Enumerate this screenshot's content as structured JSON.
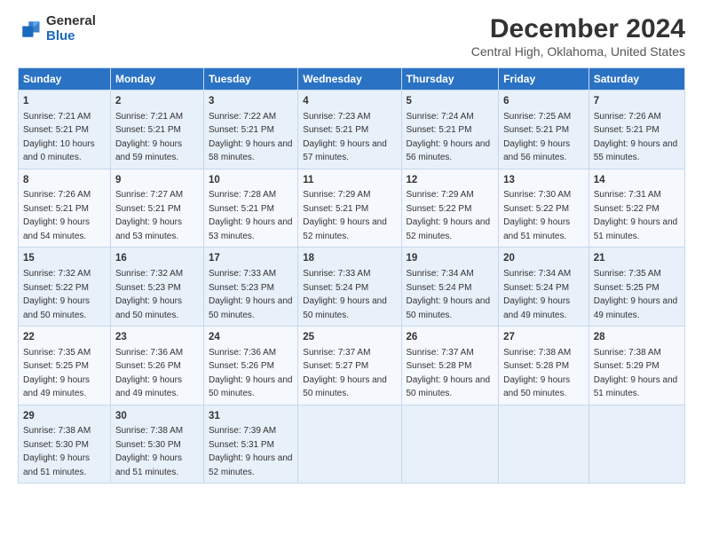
{
  "logo": {
    "general": "General",
    "blue": "Blue"
  },
  "title": "December 2024",
  "subtitle": "Central High, Oklahoma, United States",
  "days_header": [
    "Sunday",
    "Monday",
    "Tuesday",
    "Wednesday",
    "Thursday",
    "Friday",
    "Saturday"
  ],
  "weeks": [
    [
      {
        "num": "1",
        "sunrise": "7:21 AM",
        "sunset": "5:21 PM",
        "daylight": "10 hours and 0 minutes."
      },
      {
        "num": "2",
        "sunrise": "7:21 AM",
        "sunset": "5:21 PM",
        "daylight": "9 hours and 59 minutes."
      },
      {
        "num": "3",
        "sunrise": "7:22 AM",
        "sunset": "5:21 PM",
        "daylight": "9 hours and 58 minutes."
      },
      {
        "num": "4",
        "sunrise": "7:23 AM",
        "sunset": "5:21 PM",
        "daylight": "9 hours and 57 minutes."
      },
      {
        "num": "5",
        "sunrise": "7:24 AM",
        "sunset": "5:21 PM",
        "daylight": "9 hours and 56 minutes."
      },
      {
        "num": "6",
        "sunrise": "7:25 AM",
        "sunset": "5:21 PM",
        "daylight": "9 hours and 56 minutes."
      },
      {
        "num": "7",
        "sunrise": "7:26 AM",
        "sunset": "5:21 PM",
        "daylight": "9 hours and 55 minutes."
      }
    ],
    [
      {
        "num": "8",
        "sunrise": "7:26 AM",
        "sunset": "5:21 PM",
        "daylight": "9 hours and 54 minutes."
      },
      {
        "num": "9",
        "sunrise": "7:27 AM",
        "sunset": "5:21 PM",
        "daylight": "9 hours and 53 minutes."
      },
      {
        "num": "10",
        "sunrise": "7:28 AM",
        "sunset": "5:21 PM",
        "daylight": "9 hours and 53 minutes."
      },
      {
        "num": "11",
        "sunrise": "7:29 AM",
        "sunset": "5:21 PM",
        "daylight": "9 hours and 52 minutes."
      },
      {
        "num": "12",
        "sunrise": "7:29 AM",
        "sunset": "5:22 PM",
        "daylight": "9 hours and 52 minutes."
      },
      {
        "num": "13",
        "sunrise": "7:30 AM",
        "sunset": "5:22 PM",
        "daylight": "9 hours and 51 minutes."
      },
      {
        "num": "14",
        "sunrise": "7:31 AM",
        "sunset": "5:22 PM",
        "daylight": "9 hours and 51 minutes."
      }
    ],
    [
      {
        "num": "15",
        "sunrise": "7:32 AM",
        "sunset": "5:22 PM",
        "daylight": "9 hours and 50 minutes."
      },
      {
        "num": "16",
        "sunrise": "7:32 AM",
        "sunset": "5:23 PM",
        "daylight": "9 hours and 50 minutes."
      },
      {
        "num": "17",
        "sunrise": "7:33 AM",
        "sunset": "5:23 PM",
        "daylight": "9 hours and 50 minutes."
      },
      {
        "num": "18",
        "sunrise": "7:33 AM",
        "sunset": "5:24 PM",
        "daylight": "9 hours and 50 minutes."
      },
      {
        "num": "19",
        "sunrise": "7:34 AM",
        "sunset": "5:24 PM",
        "daylight": "9 hours and 50 minutes."
      },
      {
        "num": "20",
        "sunrise": "7:34 AM",
        "sunset": "5:24 PM",
        "daylight": "9 hours and 49 minutes."
      },
      {
        "num": "21",
        "sunrise": "7:35 AM",
        "sunset": "5:25 PM",
        "daylight": "9 hours and 49 minutes."
      }
    ],
    [
      {
        "num": "22",
        "sunrise": "7:35 AM",
        "sunset": "5:25 PM",
        "daylight": "9 hours and 49 minutes."
      },
      {
        "num": "23",
        "sunrise": "7:36 AM",
        "sunset": "5:26 PM",
        "daylight": "9 hours and 49 minutes."
      },
      {
        "num": "24",
        "sunrise": "7:36 AM",
        "sunset": "5:26 PM",
        "daylight": "9 hours and 50 minutes."
      },
      {
        "num": "25",
        "sunrise": "7:37 AM",
        "sunset": "5:27 PM",
        "daylight": "9 hours and 50 minutes."
      },
      {
        "num": "26",
        "sunrise": "7:37 AM",
        "sunset": "5:28 PM",
        "daylight": "9 hours and 50 minutes."
      },
      {
        "num": "27",
        "sunrise": "7:38 AM",
        "sunset": "5:28 PM",
        "daylight": "9 hours and 50 minutes."
      },
      {
        "num": "28",
        "sunrise": "7:38 AM",
        "sunset": "5:29 PM",
        "daylight": "9 hours and 51 minutes."
      }
    ],
    [
      {
        "num": "29",
        "sunrise": "7:38 AM",
        "sunset": "5:30 PM",
        "daylight": "9 hours and 51 minutes."
      },
      {
        "num": "30",
        "sunrise": "7:38 AM",
        "sunset": "5:30 PM",
        "daylight": "9 hours and 51 minutes."
      },
      {
        "num": "31",
        "sunrise": "7:39 AM",
        "sunset": "5:31 PM",
        "daylight": "9 hours and 52 minutes."
      },
      null,
      null,
      null,
      null
    ]
  ],
  "labels": {
    "sunrise": "Sunrise: ",
    "sunset": "Sunset: ",
    "daylight": "Daylight: "
  }
}
